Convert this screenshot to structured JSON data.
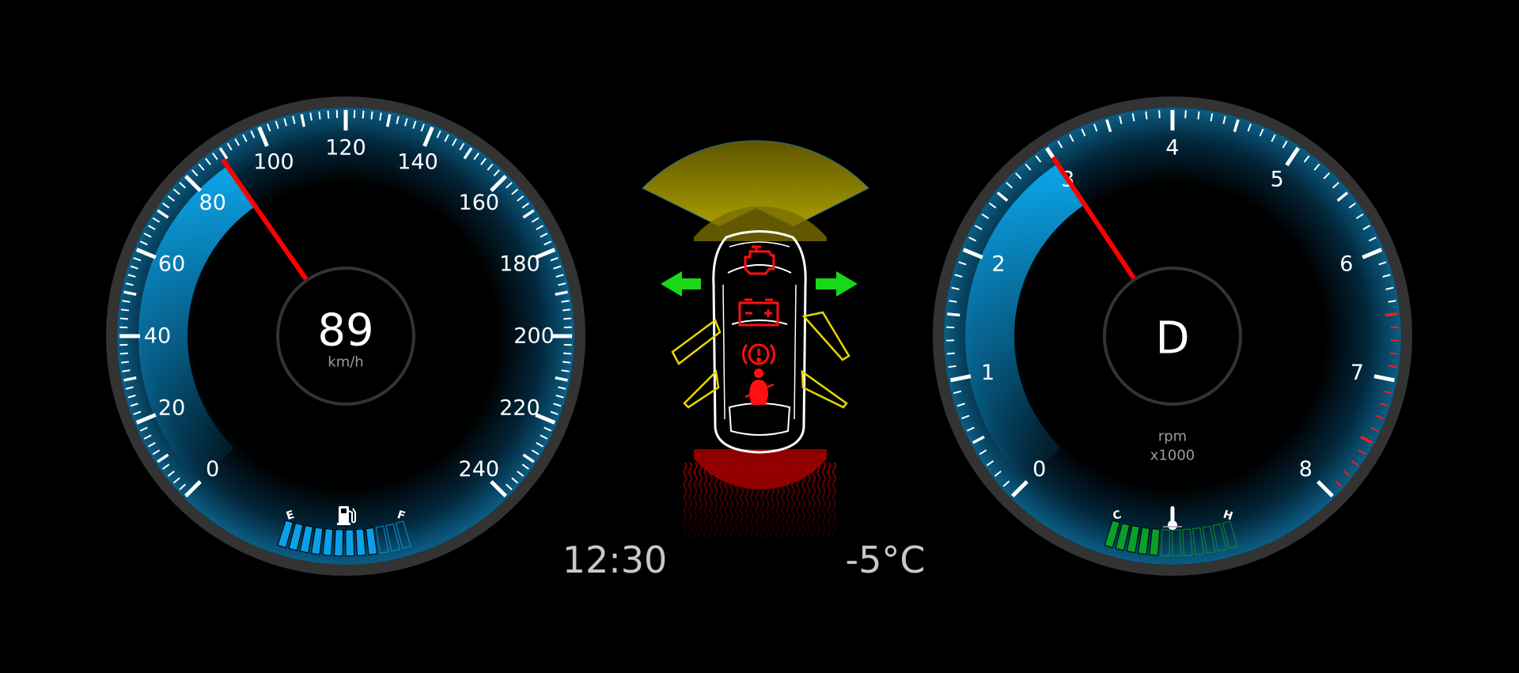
{
  "speedometer": {
    "value": 89,
    "value_text": "89",
    "unit": "km/h",
    "min": 0,
    "max": 240,
    "labels": [
      "0",
      "20",
      "40",
      "60",
      "80",
      "100",
      "120",
      "140",
      "160",
      "180",
      "200",
      "220",
      "240"
    ]
  },
  "tachometer": {
    "value": 3,
    "gear": "D",
    "unit": "rpm",
    "multiplier": "x1000",
    "min": 0,
    "max": 8,
    "redline_from": 6.5,
    "labels": [
      "0",
      "1",
      "2",
      "3",
      "4",
      "5",
      "6",
      "7",
      "8"
    ]
  },
  "fuel": {
    "empty_label": "E",
    "full_label": "F",
    "icon": "fuel-pump-icon",
    "segments": 12,
    "lit_segments": 9,
    "level": 0.75
  },
  "coolant": {
    "cold_label": "C",
    "hot_label": "H",
    "icon": "thermometer-icon",
    "segments": 12,
    "lit_segments": 5
  },
  "clock": "12:30",
  "outside_temperature": "-5°C",
  "warnings": [
    "check-engine-icon",
    "battery-icon",
    "parking-brake-icon",
    "seatbelt-icon"
  ],
  "indicators": {
    "left_turn": true,
    "right_turn": true,
    "doors_open": [
      "front-left",
      "rear-left",
      "front-right",
      "rear-right"
    ],
    "front_proximity": "warning",
    "rear_proximity": "danger"
  },
  "colors": {
    "needle": "#ff0000",
    "arc": "#0a9ad8",
    "fuel": "#0aa0e8",
    "coolant": "#0a9e2a",
    "turn_signal": "#18d818",
    "warning": "#ff1010",
    "door": "#e8d800",
    "ring": "#333333"
  }
}
